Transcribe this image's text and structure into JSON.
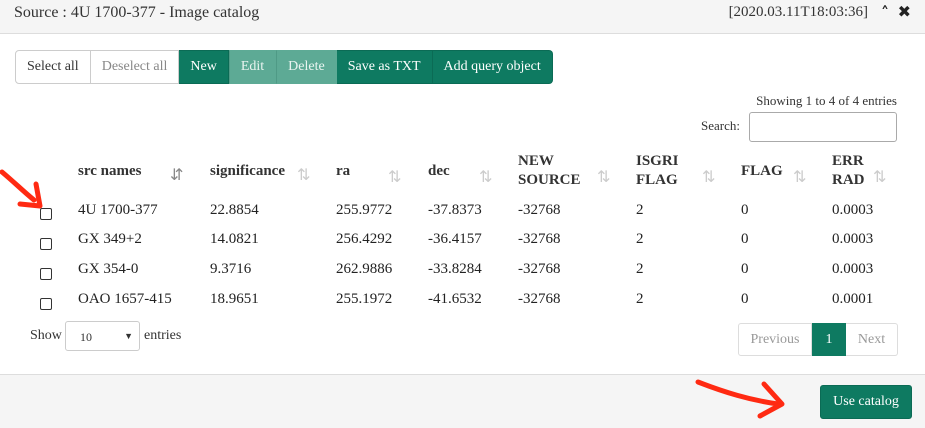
{
  "header": {
    "title": "Source : 4U 1700-377 - Image catalog",
    "timestamp": "[2020.03.11T18:03:36]",
    "collapse_icon": "chevron-up-icon",
    "close_icon": "close-icon"
  },
  "toolbar": {
    "select_all": "Select all",
    "deselect_all": "Deselect all",
    "new": "New",
    "edit": "Edit",
    "delete": "Delete",
    "save_txt": "Save as TXT",
    "add_query": "Add query object"
  },
  "table_info": "Showing 1 to 4 of 4 entries",
  "search": {
    "label": "Search:",
    "value": ""
  },
  "columns": [
    {
      "line1": "src names",
      "line2": "",
      "sort": "sorted-ascending"
    },
    {
      "line1": "significance",
      "line2": "",
      "sort": "sortable"
    },
    {
      "line1": "ra",
      "line2": "",
      "sort": "sortable"
    },
    {
      "line1": "dec",
      "line2": "",
      "sort": "sortable"
    },
    {
      "line1": "NEW",
      "line2": "SOURCE",
      "sort": "sortable"
    },
    {
      "line1": "ISGRI",
      "line2": "FLAG",
      "sort": "sortable"
    },
    {
      "line1": "FLAG",
      "line2": "",
      "sort": "sortable"
    },
    {
      "line1": "ERR",
      "line2": "RAD",
      "sort": "sortable"
    }
  ],
  "rows": [
    {
      "src": "4U 1700-377",
      "significance": "22.8854",
      "ra": "255.9772",
      "dec": "-37.8373",
      "new_source": "-32768",
      "isgri_flag": "2",
      "flag": "0",
      "err_rad": "0.0003",
      "checked": false
    },
    {
      "src": "GX 349+2",
      "significance": "14.0821",
      "ra": "256.4292",
      "dec": "-36.4157",
      "new_source": "-32768",
      "isgri_flag": "2",
      "flag": "0",
      "err_rad": "0.0003",
      "checked": false
    },
    {
      "src": "GX 354-0",
      "significance": "9.3716",
      "ra": "262.9886",
      "dec": "-33.8284",
      "new_source": "-32768",
      "isgri_flag": "2",
      "flag": "0",
      "err_rad": "0.0003",
      "checked": false
    },
    {
      "src": "OAO 1657-415",
      "significance": "18.9651",
      "ra": "255.1972",
      "dec": "-41.6532",
      "new_source": "-32768",
      "isgri_flag": "2",
      "flag": "0",
      "err_rad": "0.0001",
      "checked": false
    }
  ],
  "length_menu": {
    "show": "Show",
    "value": "10",
    "entries": "entries"
  },
  "pagination": {
    "previous": "Previous",
    "current": "1",
    "next": "Next"
  },
  "footer": {
    "use_catalog": "Use catalog"
  },
  "colors": {
    "accent": "#0e7a61",
    "accent_faded": "#5daa95",
    "annotation_arrow": "#ff2a12"
  }
}
